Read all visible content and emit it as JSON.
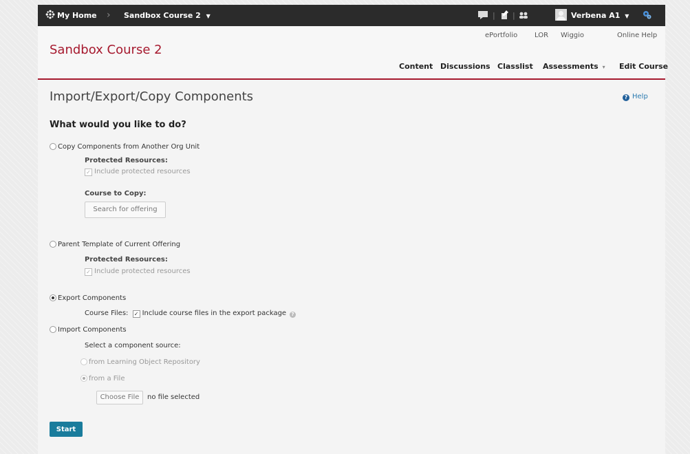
{
  "topbar": {
    "home_label": "My Home",
    "course_label": "Sandbox Course 2",
    "user_label": "Verbena A1"
  },
  "header": {
    "course_title": "Sandbox Course 2",
    "links": [
      "ePortfolio",
      "LOR",
      "Wiggio",
      "Online Help"
    ],
    "nav": [
      "Content",
      "Discussions",
      "Classlist",
      "Assessments",
      "Edit Course"
    ]
  },
  "page": {
    "title": "Import/Export/Copy Components",
    "help_label": "Help",
    "question": "What would you like to do?"
  },
  "options": {
    "copy": {
      "label": "Copy Components from Another Org Unit",
      "protected_heading": "Protected Resources:",
      "protected_checkbox": "Include protected resources",
      "course_heading": "Course to Copy:",
      "search_button": "Search for offering"
    },
    "parent": {
      "label": "Parent Template of Current Offering",
      "protected_heading": "Protected Resources:",
      "protected_checkbox": "Include protected resources"
    },
    "export": {
      "label": "Export Components",
      "course_files_label": "Course Files:",
      "course_files_checkbox": "Include course files in the export package"
    },
    "import": {
      "label": "Import Components",
      "source_prompt": "Select a component source:",
      "source_lor": "from Learning Object Repository",
      "source_file": "from a File",
      "choose_file_button": "Choose File",
      "file_status": "no file selected"
    }
  },
  "start_label": "Start",
  "colors": {
    "accent": "#a6192e",
    "topbar": "#2b2b2b",
    "primary_button": "#1a7c9c",
    "link": "#2a7ab0"
  },
  "icons": [
    "daisy-logo-icon",
    "chevron-right-icon",
    "caret-down-icon",
    "message-icon",
    "pencil-icon",
    "people-icon",
    "avatar",
    "gear-icon",
    "help-icon",
    "question-icon"
  ]
}
